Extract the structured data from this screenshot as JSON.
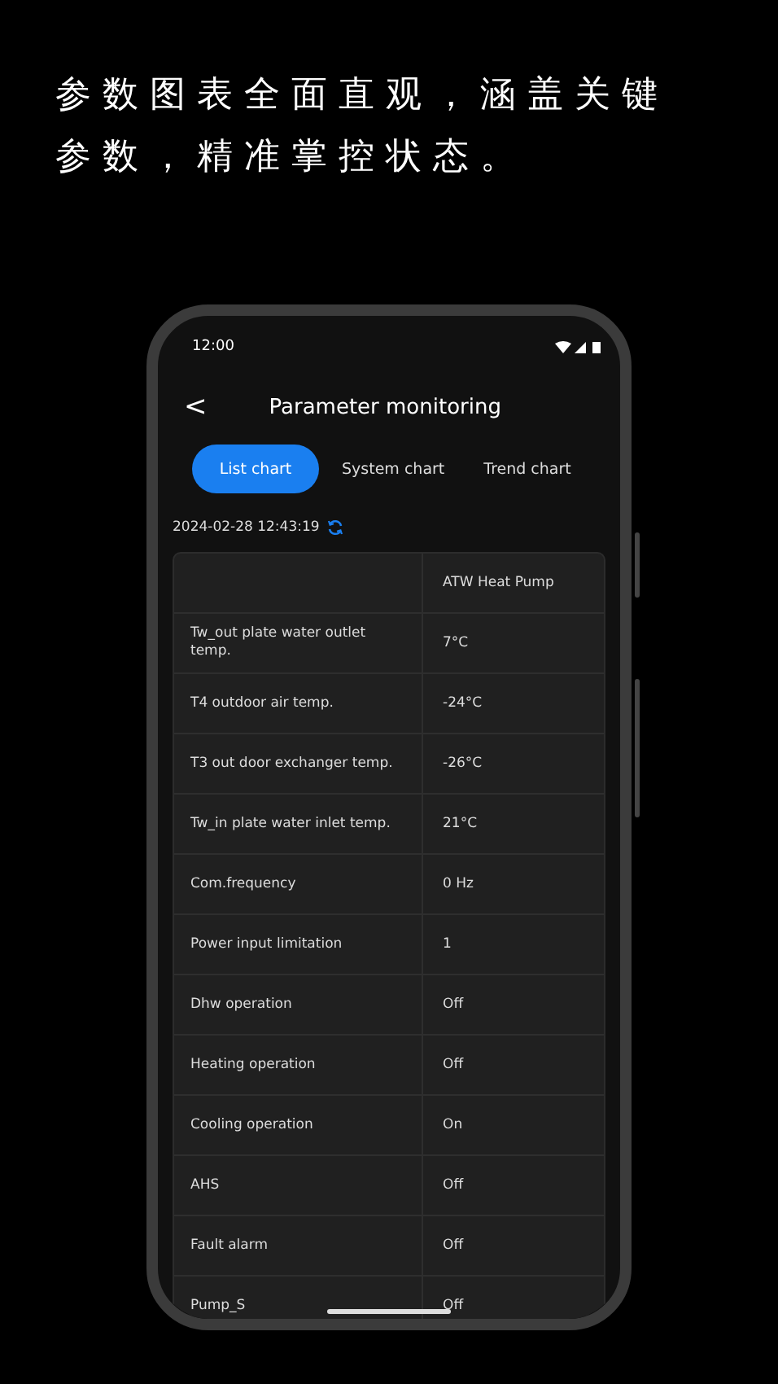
{
  "headline": "参数图表全面直观，涵盖关键参数，精准掌控状态。",
  "status_bar": {
    "time": "12:00"
  },
  "header": {
    "back": "<",
    "title": "Parameter monitoring"
  },
  "tabs": [
    {
      "label": "List chart",
      "selected": true
    },
    {
      "label": "System chart",
      "selected": false
    },
    {
      "label": "Trend chart",
      "selected": false
    }
  ],
  "timestamp": "2024-02-28 12:43:19",
  "table": {
    "columns": [
      "",
      "ATW Heat Pump"
    ],
    "rows": [
      [
        "Tw_out plate water outlet temp.",
        "7°C"
      ],
      [
        "T4 outdoor air temp.",
        "-24°C"
      ],
      [
        "T3 out door exchanger temp.",
        "-26°C"
      ],
      [
        "Tw_in plate water inlet temp.",
        "21°C"
      ],
      [
        "Com.frequency",
        "0 Hz"
      ],
      [
        "Power input limitation",
        "1"
      ],
      [
        "Dhw operation",
        "Off"
      ],
      [
        "Heating operation",
        "Off"
      ],
      [
        "Cooling operation",
        "On"
      ],
      [
        "AHS",
        "Off"
      ],
      [
        "Fault alarm",
        "Off"
      ],
      [
        "Pump_S",
        "Off"
      ]
    ]
  }
}
